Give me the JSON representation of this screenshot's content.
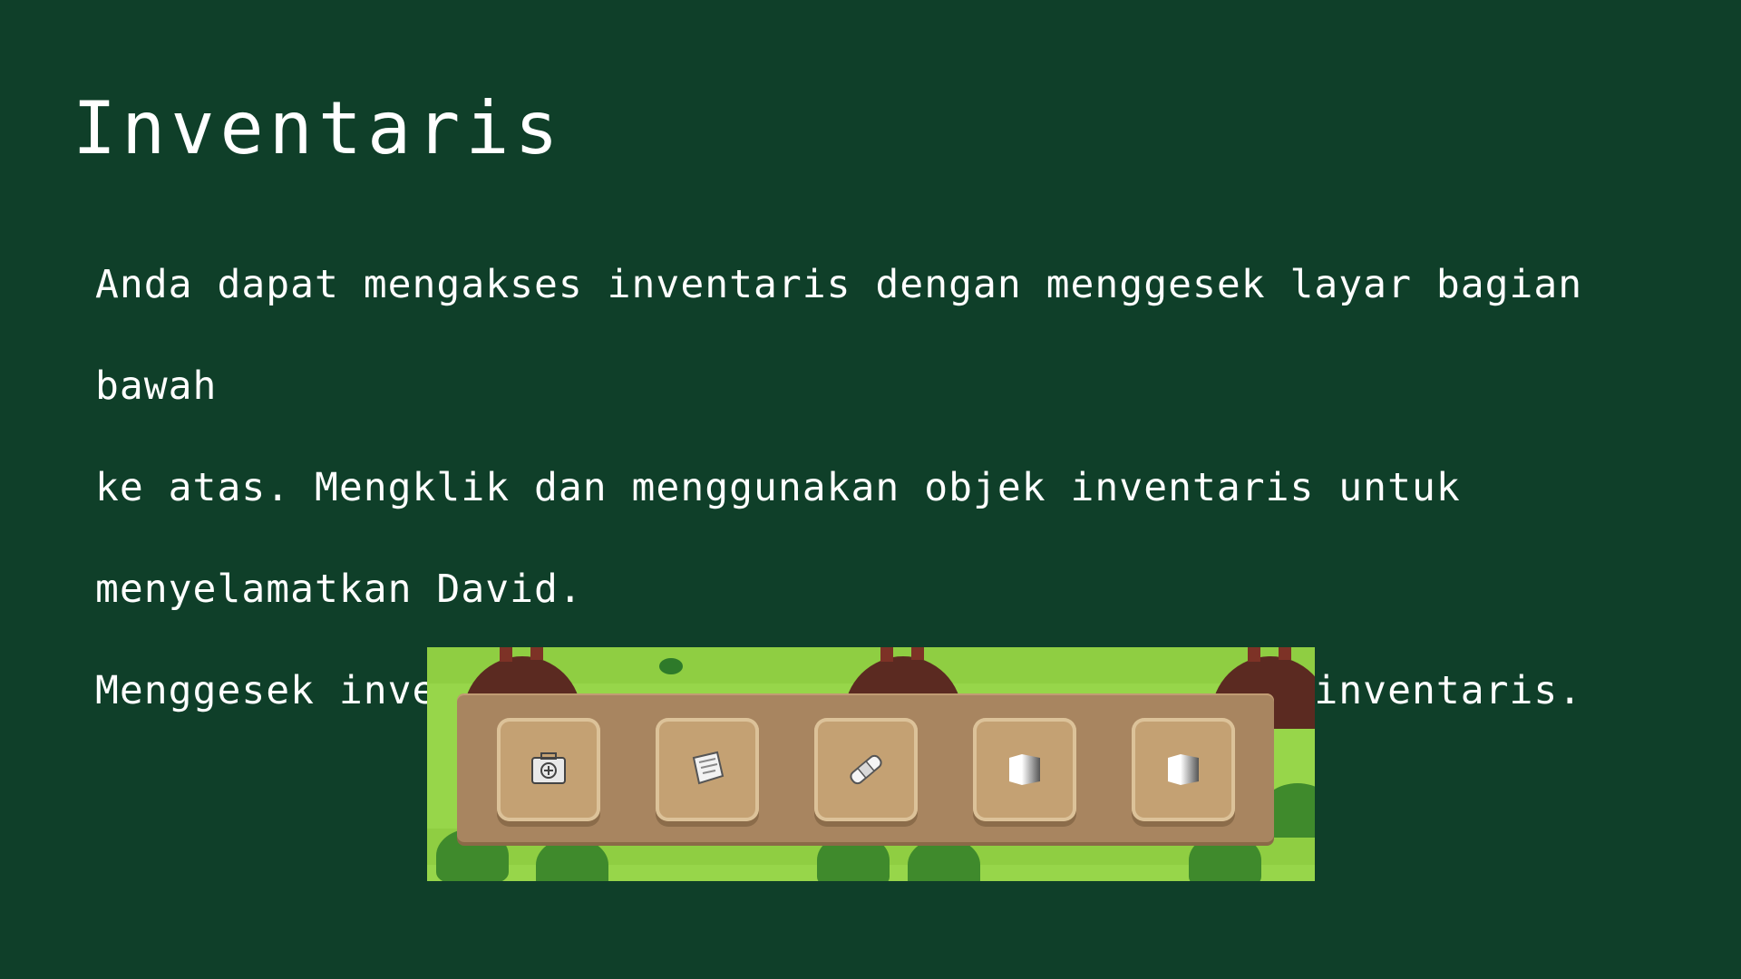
{
  "title": "Inventaris",
  "paragraphs": [
    "Anda dapat mengakses inventaris dengan menggesek layar bagian bawah",
    "ke atas. Mengklik dan menggunakan objek inventaris untuk",
    "menyelamatkan David.",
    "Menggesek inventaris ke bawah akan menyembunyikan inventaris."
  ],
  "inventory": {
    "slots": [
      {
        "icon": "first-aid-kit-icon"
      },
      {
        "icon": "paper-icon"
      },
      {
        "icon": "bandage-icon"
      },
      {
        "icon": "empty-item-icon"
      },
      {
        "icon": "empty-item-icon"
      }
    ]
  },
  "colors": {
    "background": "#0f3f29",
    "text": "#ffffff",
    "grass": "#97d64a",
    "inventory_bar": "#a88560",
    "slot": "#c4a173"
  }
}
